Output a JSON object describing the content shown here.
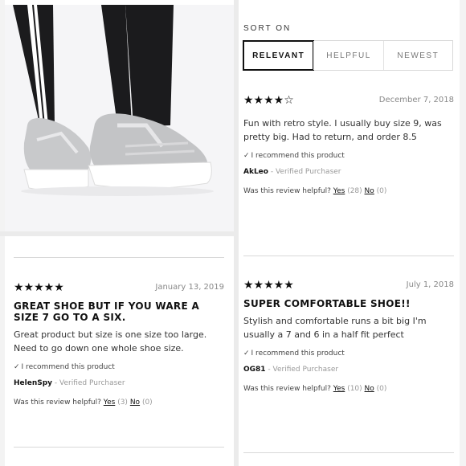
{
  "sort": {
    "label": "SORT ON",
    "options": [
      "RELEVANT",
      "HELPFUL",
      "NEWEST"
    ],
    "active": "RELEVANT"
  },
  "reviews": [
    {
      "stars": "★★★★☆",
      "rating": 4,
      "date": "December 7, 2018",
      "title": "",
      "body": "Fun with retro style. I usually buy size 9, was pretty big. Had to return, and order 8.5",
      "recommend": "I recommend this product",
      "author": "AkLeo",
      "verified": " - Verified Purchaser",
      "helpful_q": "Was this review helpful?",
      "yes": "Yes",
      "yes_count": "(28)",
      "no": "No",
      "no_count": "(0)"
    },
    {
      "stars": "★★★★★",
      "rating": 5,
      "date": "January 13, 2019",
      "title": "GREAT SHOE BUT IF YOU WARE A SIZE 7 GO TO A SIX.",
      "body": "Great product but size is one size too large. Need to go down one whole shoe size.",
      "recommend": "I recommend this product",
      "author": "HelenSpy",
      "verified": " - Verified Purchaser",
      "helpful_q": "Was this review helpful?",
      "yes": "Yes",
      "yes_count": "(3)",
      "no": "No",
      "no_count": "(0)"
    },
    {
      "stars": "★★★★★",
      "rating": 5,
      "date": "July 1, 2018",
      "title": "SUPER COMFORTABLE SHOE!!",
      "body": "Stylish and comfortable runs a bit big I'm usually a 7 and 6 in a half fit perfect",
      "recommend": "I recommend this product",
      "author": "OG81",
      "verified": " - Verified Purchaser",
      "helpful_q": "Was this review helpful?",
      "yes": "Yes",
      "yes_count": "(10)",
      "no": "No",
      "no_count": "(0)"
    }
  ],
  "colors": {
    "accent": "#111111",
    "muted": "#888888",
    "shoe": "#c9cacc",
    "sole": "#ffffff",
    "pants": "#1a1a1c"
  }
}
